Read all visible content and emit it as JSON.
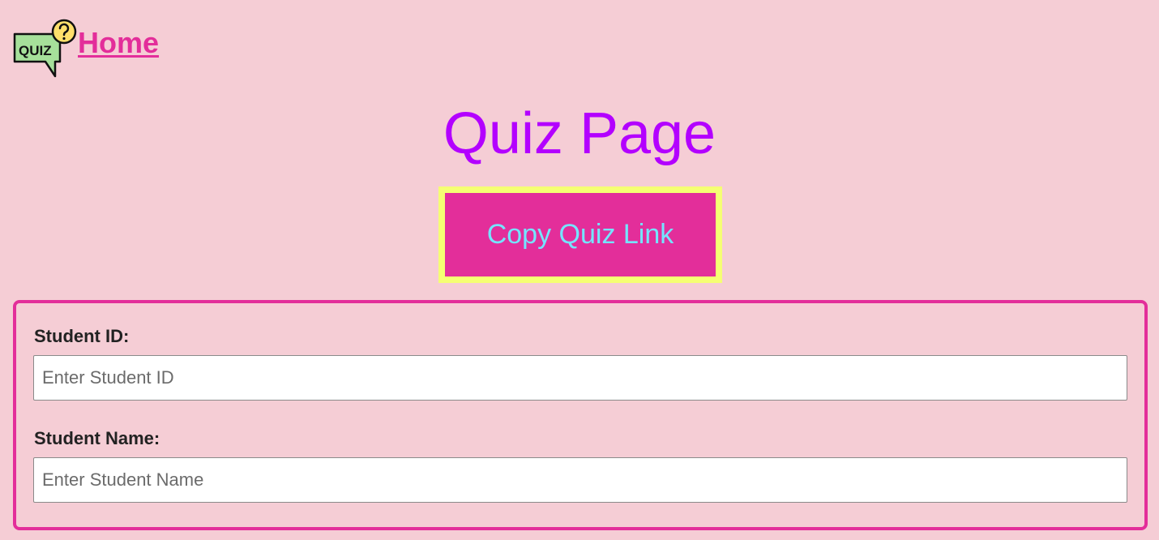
{
  "nav": {
    "logo_text": "QUIZ",
    "home_label": "Home"
  },
  "page": {
    "title": "Quiz Page",
    "copy_button_label": "Copy Quiz Link"
  },
  "form": {
    "student_id": {
      "label": "Student ID:",
      "placeholder": "Enter Student ID",
      "value": ""
    },
    "student_name": {
      "label": "Student Name:",
      "placeholder": "Enter Student Name",
      "value": ""
    }
  },
  "colors": {
    "background": "#f5cdd5",
    "accent_pink": "#e32e9a",
    "title_purple": "#b300ff",
    "button_border_yellow": "#f5ff73",
    "button_text_cyan": "#74e5ff",
    "logo_green": "#a6e09a",
    "logo_yellow": "#ffe06b"
  },
  "icons": {
    "logo": "quiz-speech-bubble-question-icon"
  }
}
